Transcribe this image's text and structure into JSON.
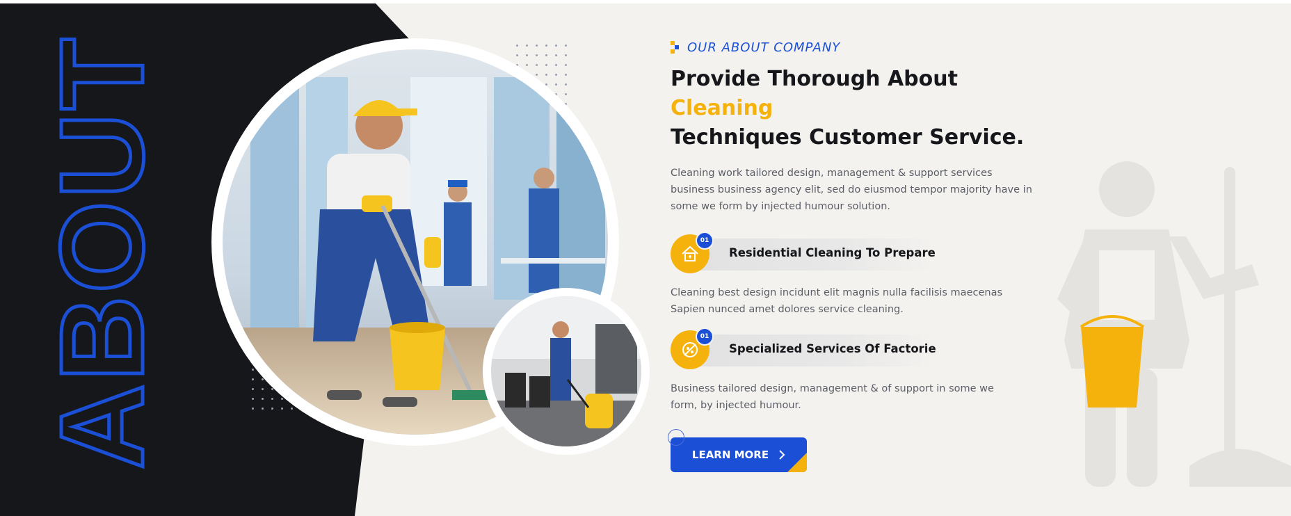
{
  "vertical_word": "ABOUT",
  "tagline": {
    "text": "OUR ABOUT COMPANY"
  },
  "heading": {
    "part1": "Provide Thorough About ",
    "highlight": "Cleaning",
    "part2": "Techniques Customer Service."
  },
  "description": "Cleaning work tailored design, management & support services business business agency elit, sed do eiusmod tempor  majority have in some we form by injected humour solution.",
  "features": [
    {
      "number": "01",
      "title": "Residential Cleaning To Prepare",
      "icon": "house-sparkle-icon",
      "description": "Cleaning best design incidunt elit magnis nulla facilisis maecenas Sapien nunced amet dolores service cleaning."
    },
    {
      "number": "01",
      "title": "Specialized Services Of Factorie",
      "icon": "no-bacteria-icon",
      "description": "Business tailored design, management & of support in some we form, by injected humour."
    }
  ],
  "cta": {
    "label": "LEARN MORE",
    "icon": "chevron-right-icon"
  },
  "colors": {
    "accent_blue": "#1a4fd6",
    "accent_yellow": "#f6b20c",
    "dark": "#16171b",
    "bg": "#f4f2ef"
  }
}
